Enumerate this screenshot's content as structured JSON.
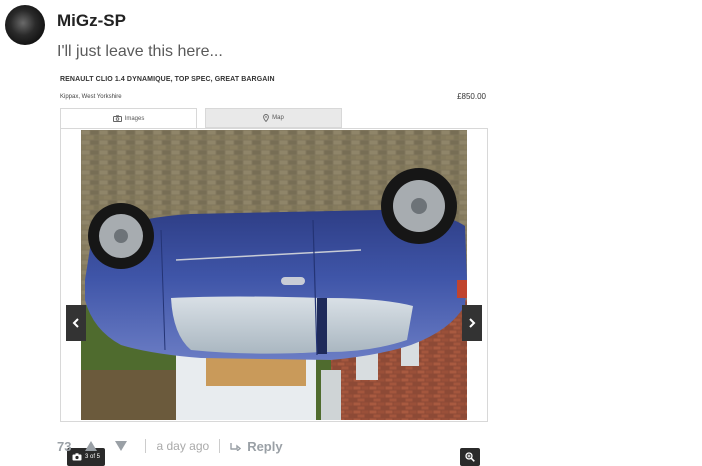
{
  "comment": {
    "username": "MiGz-SP",
    "text": "I'll just leave this here...",
    "score": "73",
    "timestamp": "a day ago",
    "reply_label": "Reply"
  },
  "listing": {
    "title": "RENAULT CLIO 1.4 DYNAMIQUE, TOP SPEC, GREAT BARGAIN",
    "location": "Kippax, West Yorkshire",
    "price": "£850.00",
    "tabs": [
      {
        "label": "Images",
        "icon": "camera-icon",
        "active": true
      },
      {
        "label": "Map",
        "icon": "map-pin-icon",
        "active": false
      }
    ],
    "gallery": {
      "counter": "3 of 5",
      "prev_icon": "chevron-left-icon",
      "next_icon": "chevron-right-icon",
      "zoom_icon": "zoom-in-icon"
    }
  },
  "colors": {
    "username": "#222222",
    "comment_text": "#5a5a5a",
    "meta_grey": "#aaaaaa",
    "car_blue": "#3b4f9e",
    "gallery_button_bg": "#333333"
  }
}
